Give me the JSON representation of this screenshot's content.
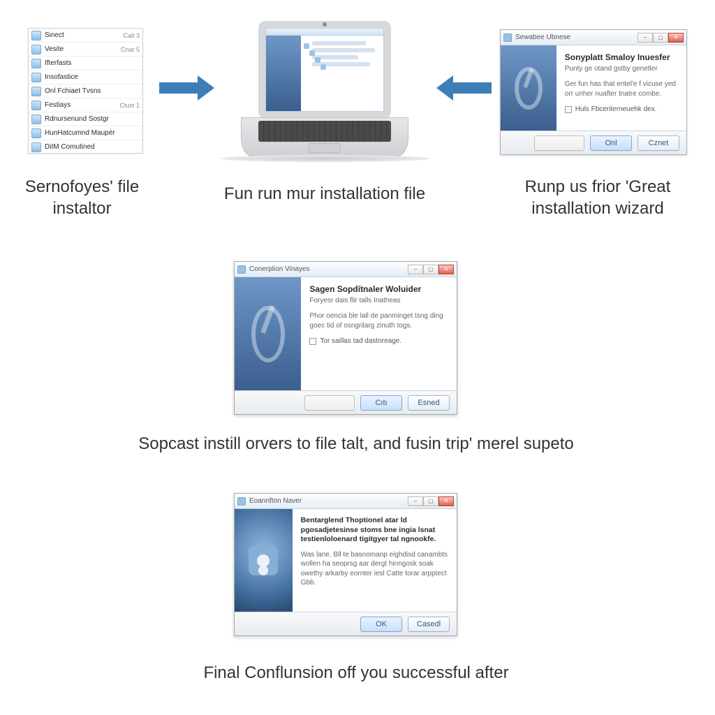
{
  "row1": {
    "panel": {
      "items": [
        {
          "name": "Sinect",
          "meta": "Calt 3"
        },
        {
          "name": "Vesite",
          "meta": "Cnar 5"
        },
        {
          "name": "Ifterfasts",
          "meta": ""
        },
        {
          "name": "Insofastice",
          "meta": ""
        },
        {
          "name": "Onl Fchiaet Tvsns",
          "meta": ""
        },
        {
          "name": "Festiays",
          "meta": "Ctust 1"
        },
        {
          "name": "Rdnursenund Sostgr",
          "meta": ""
        },
        {
          "name": "HunHatcumnd Maupér",
          "meta": ""
        },
        {
          "name": "DiIM Comutined",
          "meta": ""
        }
      ],
      "caption": "Sernofoyes' file instaltor"
    },
    "laptop_caption": "Fun run mur installation file",
    "wizard": {
      "titlebar": "Sewabee Ubnese",
      "title": "Sonyplatt Smaloy Inuesfer",
      "subtitle": "Punty ge otand gstby genetler",
      "body": "Ger fun has that entel'e f vicuse yed orr unher nuafter tnatre combe.",
      "checkbox": "Huls Fbceriterneuehk dex.",
      "ok": "Onl",
      "cancel": "Cznet",
      "caption": "Runp us frior 'Great installation wizard"
    }
  },
  "row2": {
    "wizard": {
      "titlebar": "Conerplion Vinayes",
      "title": "Sagen Sopdítnaler Woluider",
      "subtitle": "Foryesr dais flir talls Inatheas",
      "body": "Phor oencia ble lall de panminget tsng ding goec tid of osngrilarg zinuth togs.",
      "checkbox": "Tor saillas tad dastnreage.",
      "ok": "Cıtı",
      "cancel": "Esned"
    },
    "caption": "Sopcast instill orvers to file talt, and fusin trip' merel supeto"
  },
  "row3": {
    "wizard": {
      "titlebar": "Eoannfton Naver",
      "title": "Bentarglend Thoptionel atar ld pgosadjetesinse stoms bne ingia lsnat testienloloenard tigitgyer tal ngnookfe.",
      "body": "Was lane. Bll te basnomanp eighdisd canambts wollen ha seoprsg aar dergt hinngosk soak owethy arkarby eornter iesl Catte torar arpptect Gbb.",
      "ok": "OK",
      "cancel": "Casedl"
    },
    "caption": "Final Conflunsion off you successful after"
  }
}
